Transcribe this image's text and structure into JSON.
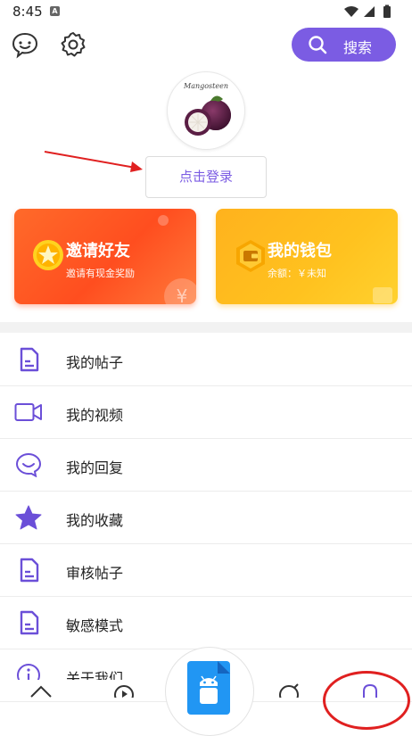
{
  "status_bar": {
    "time": "8:45",
    "notif_letter": "A"
  },
  "search": {
    "label": "搜索"
  },
  "profile": {
    "avatar_caption": "Mangosteen",
    "login_label": "点击登录"
  },
  "cards": {
    "invite": {
      "title": "邀请好友",
      "subtitle": "邀请有现金奖励"
    },
    "wallet": {
      "title": "我的钱包",
      "subtitle": "余额：￥未知"
    }
  },
  "menu": {
    "items": [
      {
        "label": "我的帖子",
        "icon": "document-icon"
      },
      {
        "label": "我的视频",
        "icon": "video-icon"
      },
      {
        "label": "我的回复",
        "icon": "smile-chat-icon"
      },
      {
        "label": "我的收藏",
        "icon": "star-icon"
      },
      {
        "label": "审核帖子",
        "icon": "document-icon"
      },
      {
        "label": "敏感模式",
        "icon": "document-icon"
      },
      {
        "label": "关于我们",
        "icon": "info-icon"
      }
    ]
  },
  "colors": {
    "accent": "#7b5ce3",
    "invite": "#ff5a24",
    "wallet": "#ffbb1f",
    "annotation": "#e02020"
  }
}
